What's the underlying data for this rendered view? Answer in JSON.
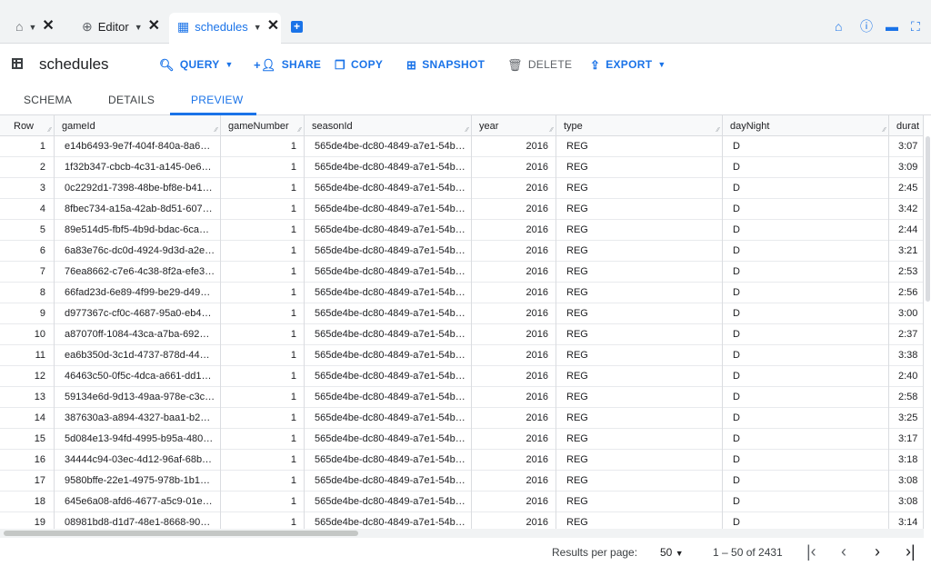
{
  "tabs": [
    {
      "label": "",
      "icon": "home-icon"
    },
    {
      "label": "Editor",
      "icon": "query-icon"
    },
    {
      "label": "schedules",
      "icon": "table-icon",
      "active": true
    }
  ],
  "top_icons": [
    "notifications-home-icon",
    "info-icon",
    "keyboard-icon",
    "fullscreen-icon"
  ],
  "header": {
    "title": "schedules"
  },
  "toolbar": {
    "query": "QUERY",
    "share": "SHARE",
    "copy": "COPY",
    "snapshot": "SNAPSHOT",
    "delete": "DELETE",
    "export": "EXPORT"
  },
  "subtabs": {
    "schema": "SCHEMA",
    "details": "DETAILS",
    "preview": "PREVIEW"
  },
  "columns": [
    "Row",
    "gameId",
    "gameNumber",
    "seasonId",
    "year",
    "type",
    "dayNight",
    "durat"
  ],
  "rows": [
    [
      "1",
      "e14b6493-9e7f-404f-840a-8a6…",
      "1",
      "565de4be-dc80-4849-a7e1-54b…",
      "2016",
      "REG",
      "D",
      "3:07"
    ],
    [
      "2",
      "1f32b347-cbcb-4c31-a145-0e6…",
      "1",
      "565de4be-dc80-4849-a7e1-54b…",
      "2016",
      "REG",
      "D",
      "3:09"
    ],
    [
      "3",
      "0c2292d1-7398-48be-bf8e-b41…",
      "1",
      "565de4be-dc80-4849-a7e1-54b…",
      "2016",
      "REG",
      "D",
      "2:45"
    ],
    [
      "4",
      "8fbec734-a15a-42ab-8d51-607…",
      "1",
      "565de4be-dc80-4849-a7e1-54b…",
      "2016",
      "REG",
      "D",
      "3:42"
    ],
    [
      "5",
      "89e514d5-fbf5-4b9d-bdac-6ca…",
      "1",
      "565de4be-dc80-4849-a7e1-54b…",
      "2016",
      "REG",
      "D",
      "2:44"
    ],
    [
      "6",
      "6a83e76c-dc0d-4924-9d3d-a2e…",
      "1",
      "565de4be-dc80-4849-a7e1-54b…",
      "2016",
      "REG",
      "D",
      "3:21"
    ],
    [
      "7",
      "76ea8662-c7e6-4c38-8f2a-efe3…",
      "1",
      "565de4be-dc80-4849-a7e1-54b…",
      "2016",
      "REG",
      "D",
      "2:53"
    ],
    [
      "8",
      "66fad23d-6e89-4f99-be29-d49…",
      "1",
      "565de4be-dc80-4849-a7e1-54b…",
      "2016",
      "REG",
      "D",
      "2:56"
    ],
    [
      "9",
      "d977367c-cf0c-4687-95a0-eb4…",
      "1",
      "565de4be-dc80-4849-a7e1-54b…",
      "2016",
      "REG",
      "D",
      "3:00"
    ],
    [
      "10",
      "a87070ff-1084-43ca-a7ba-692…",
      "1",
      "565de4be-dc80-4849-a7e1-54b…",
      "2016",
      "REG",
      "D",
      "2:37"
    ],
    [
      "11",
      "ea6b350d-3c1d-4737-878d-44…",
      "1",
      "565de4be-dc80-4849-a7e1-54b…",
      "2016",
      "REG",
      "D",
      "3:38"
    ],
    [
      "12",
      "46463c50-0f5c-4dca-a661-dd1…",
      "1",
      "565de4be-dc80-4849-a7e1-54b…",
      "2016",
      "REG",
      "D",
      "2:40"
    ],
    [
      "13",
      "59134e6d-9d13-49aa-978e-c3c…",
      "1",
      "565de4be-dc80-4849-a7e1-54b…",
      "2016",
      "REG",
      "D",
      "2:58"
    ],
    [
      "14",
      "387630a3-a894-4327-baa1-b2…",
      "1",
      "565de4be-dc80-4849-a7e1-54b…",
      "2016",
      "REG",
      "D",
      "3:25"
    ],
    [
      "15",
      "5d084e13-94fd-4995-b95a-480…",
      "1",
      "565de4be-dc80-4849-a7e1-54b…",
      "2016",
      "REG",
      "D",
      "3:17"
    ],
    [
      "16",
      "34444c94-03ec-4d12-96af-68b…",
      "1",
      "565de4be-dc80-4849-a7e1-54b…",
      "2016",
      "REG",
      "D",
      "3:18"
    ],
    [
      "17",
      "9580bffe-22e1-4975-978b-1b1…",
      "1",
      "565de4be-dc80-4849-a7e1-54b…",
      "2016",
      "REG",
      "D",
      "3:08"
    ],
    [
      "18",
      "645e6a08-afd6-4677-a5c9-01e…",
      "1",
      "565de4be-dc80-4849-a7e1-54b…",
      "2016",
      "REG",
      "D",
      "3:08"
    ],
    [
      "19",
      "08981bd8-d1d7-48e1-8668-90…",
      "1",
      "565de4be-dc80-4849-a7e1-54b…",
      "2016",
      "REG",
      "D",
      "3:14"
    ]
  ],
  "footer": {
    "results_per_page_label": "Results per page:",
    "results_per_page_value": "50",
    "range": "1 – 50 of 2431"
  },
  "colors": {
    "accent": "#1a73e8",
    "text": "#202124",
    "muted": "#5f6368"
  }
}
